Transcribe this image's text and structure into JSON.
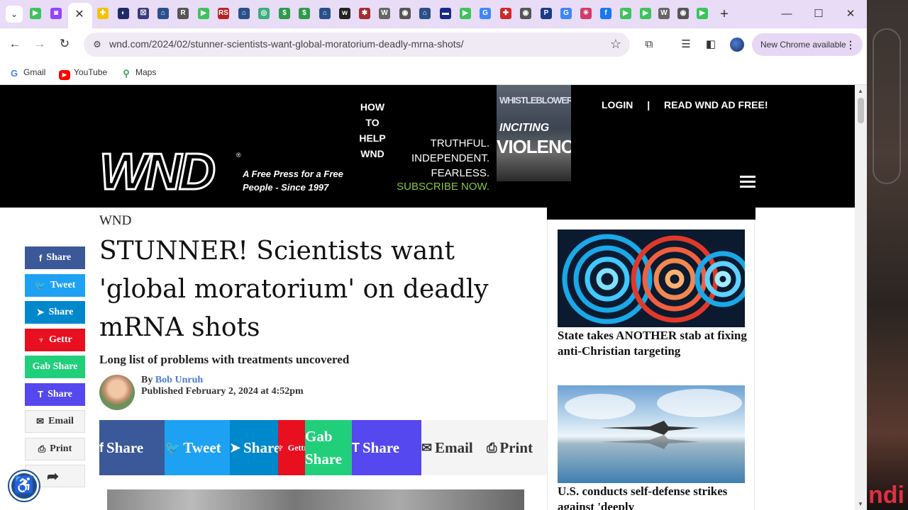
{
  "browser": {
    "url": "wnd.com/2024/02/stunner-scientists-want-global-moratorium-deadly-mrna-shots/",
    "update_label": "New Chrome available",
    "bookmarks": [
      {
        "label": "Gmail",
        "icon": "google-icon"
      },
      {
        "label": "YouTube",
        "icon": "youtube-icon"
      },
      {
        "label": "Maps",
        "icon": "maps-icon"
      }
    ],
    "tab_icons": [
      {
        "icon": "play-icon",
        "color": "#3cc35c",
        "glyph": "▶"
      },
      {
        "icon": "twitch-icon",
        "color": "#9146ff",
        "glyph": "◙"
      },
      {
        "icon": "star-icon",
        "color": "#f4c20d",
        "glyph": "✚"
      },
      {
        "icon": "site-icon",
        "color": "#1d2b6b",
        "glyph": "◐"
      },
      {
        "icon": "site-icon",
        "color": "#3a3a7a",
        "glyph": "☒"
      },
      {
        "icon": "site-icon",
        "color": "#2a4f8a",
        "glyph": "⌂"
      },
      {
        "icon": "site-icon",
        "color": "#555555",
        "glyph": "R"
      },
      {
        "icon": "play-icon",
        "color": "#3cc35c",
        "glyph": "▶"
      },
      {
        "icon": "site-icon",
        "color": "#b22",
        "glyph": "RS"
      },
      {
        "icon": "site-icon",
        "color": "#2a4f8a",
        "glyph": "⌂"
      },
      {
        "icon": "site-icon",
        "color": "#3cae7a",
        "glyph": "◎"
      },
      {
        "icon": "site-icon",
        "color": "#2f9a4a",
        "glyph": "$"
      },
      {
        "icon": "site-icon",
        "color": "#2f9a4a",
        "glyph": "$"
      },
      {
        "icon": "site-icon",
        "color": "#2a4f8a",
        "glyph": "⌂"
      },
      {
        "icon": "wnd-icon",
        "color": "#222",
        "glyph": "w"
      },
      {
        "icon": "site-icon",
        "color": "#a03030",
        "glyph": "✱"
      },
      {
        "icon": "wikipedia-icon",
        "color": "#666",
        "glyph": "W"
      },
      {
        "icon": "globe-icon",
        "color": "#555",
        "glyph": "◉"
      },
      {
        "icon": "site-icon",
        "color": "#2a4f8a",
        "glyph": "⌂"
      },
      {
        "icon": "site-icon",
        "color": "#1a2a88",
        "glyph": "▬"
      },
      {
        "icon": "play-icon",
        "color": "#3cc35c",
        "glyph": "▶"
      },
      {
        "icon": "google-icon",
        "color": "#4285f4",
        "glyph": "G"
      },
      {
        "icon": "site-icon",
        "color": "#cc2a2a",
        "glyph": "✚"
      },
      {
        "icon": "chrome-icon",
        "color": "#555",
        "glyph": "◉"
      },
      {
        "icon": "paypal-icon",
        "color": "#1b3a8a",
        "glyph": "P"
      },
      {
        "icon": "google-icon",
        "color": "#4285f4",
        "glyph": "G"
      },
      {
        "icon": "site-icon",
        "color": "#d23a6a",
        "glyph": "✳"
      },
      {
        "icon": "facebook-icon",
        "color": "#1877f2",
        "glyph": "f"
      },
      {
        "icon": "play-icon",
        "color": "#3cc35c",
        "glyph": "▶"
      },
      {
        "icon": "play-icon",
        "color": "#3cc35c",
        "glyph": "▶"
      },
      {
        "icon": "wikipedia-icon",
        "color": "#666",
        "glyph": "W"
      },
      {
        "icon": "chrome-icon",
        "color": "#555",
        "glyph": "◉"
      },
      {
        "icon": "play-icon",
        "color": "#3cc35c",
        "glyph": "▶"
      }
    ]
  },
  "header": {
    "logo_text": "WND",
    "tagline": "A Free Press for a Free People - Since 1997",
    "how_to_help": [
      "HOW",
      "TO",
      "HELP",
      "WND"
    ],
    "truthful": [
      "TRUTHFUL.",
      "INDEPENDENT.",
      "FEARLESS."
    ],
    "subscribe": "SUBSCRIBE NOW.",
    "ad": {
      "line1": "WHISTLEBLOWER",
      "line2": "INCITING",
      "line3": "VIOLENCE"
    },
    "login": "LOGIN",
    "separator": "|",
    "ad_free": "READ WND AD FREE!"
  },
  "article": {
    "kicker": "WND",
    "headline": "STUNNER! Scientists want 'global moratorium' on deadly mRNA shots",
    "dek": "Long list of problems with treatments uncovered",
    "by": "By",
    "author": "Bob Unruh",
    "published": "Published February 2, 2024 at 4:52pm"
  },
  "share_bar": [
    {
      "label": "Share",
      "icon": "facebook-icon",
      "glyph": "f",
      "color": "#3b5998"
    },
    {
      "label": "Tweet",
      "icon": "twitter-icon",
      "glyph": "🐦",
      "color": "#1da1f2"
    },
    {
      "label": "Share",
      "icon": "telegram-icon",
      "glyph": "➤",
      "color": "#0088cc"
    },
    {
      "label": "Gettr",
      "icon": "gettr-icon",
      "glyph": "♆",
      "color": "#e8101f"
    },
    {
      "label": "Gab Share",
      "icon": "gab-icon",
      "glyph": "",
      "color": "#21cf7a"
    },
    {
      "label": "Share",
      "icon": "truth-social-icon",
      "glyph": "T",
      "color": "#5448ee"
    },
    {
      "label": "Email",
      "icon": "email-icon",
      "glyph": "✉",
      "color": "#f4f4f4"
    },
    {
      "label": "Print",
      "icon": "print-icon",
      "glyph": "⎙",
      "color": "#f4f4f4"
    }
  ],
  "side_share": [
    {
      "label": "Share",
      "icon": "facebook-icon",
      "glyph": "f",
      "color": "#3b5998"
    },
    {
      "label": "Tweet",
      "icon": "twitter-icon",
      "glyph": "🐦",
      "color": "#1da1f2"
    },
    {
      "label": "Share",
      "icon": "telegram-icon",
      "glyph": "➤",
      "color": "#0088cc"
    },
    {
      "label": "Gettr",
      "icon": "gettr-icon",
      "glyph": "♆",
      "color": "#e8101f"
    },
    {
      "label": "Gab Share",
      "icon": "gab-icon",
      "glyph": "",
      "color": "#21cf7a"
    },
    {
      "label": "Share",
      "icon": "truth-social-icon",
      "glyph": "T",
      "color": "#5448ee"
    },
    {
      "label": "Email",
      "icon": "email-icon",
      "glyph": "✉",
      "color": "#f4f4f4"
    },
    {
      "label": "Print",
      "icon": "print-icon",
      "glyph": "⎙",
      "color": "#f4f4f4"
    },
    {
      "label": "",
      "icon": "forward-icon",
      "glyph": "➦",
      "color": "#f4f4f4"
    }
  ],
  "sidebar": {
    "stories": [
      {
        "title": "State takes ANOTHER stab at fixing anti-Christian targeting"
      },
      {
        "title": "U.S. conducts self-defense strikes against 'deeply"
      }
    ]
  }
}
